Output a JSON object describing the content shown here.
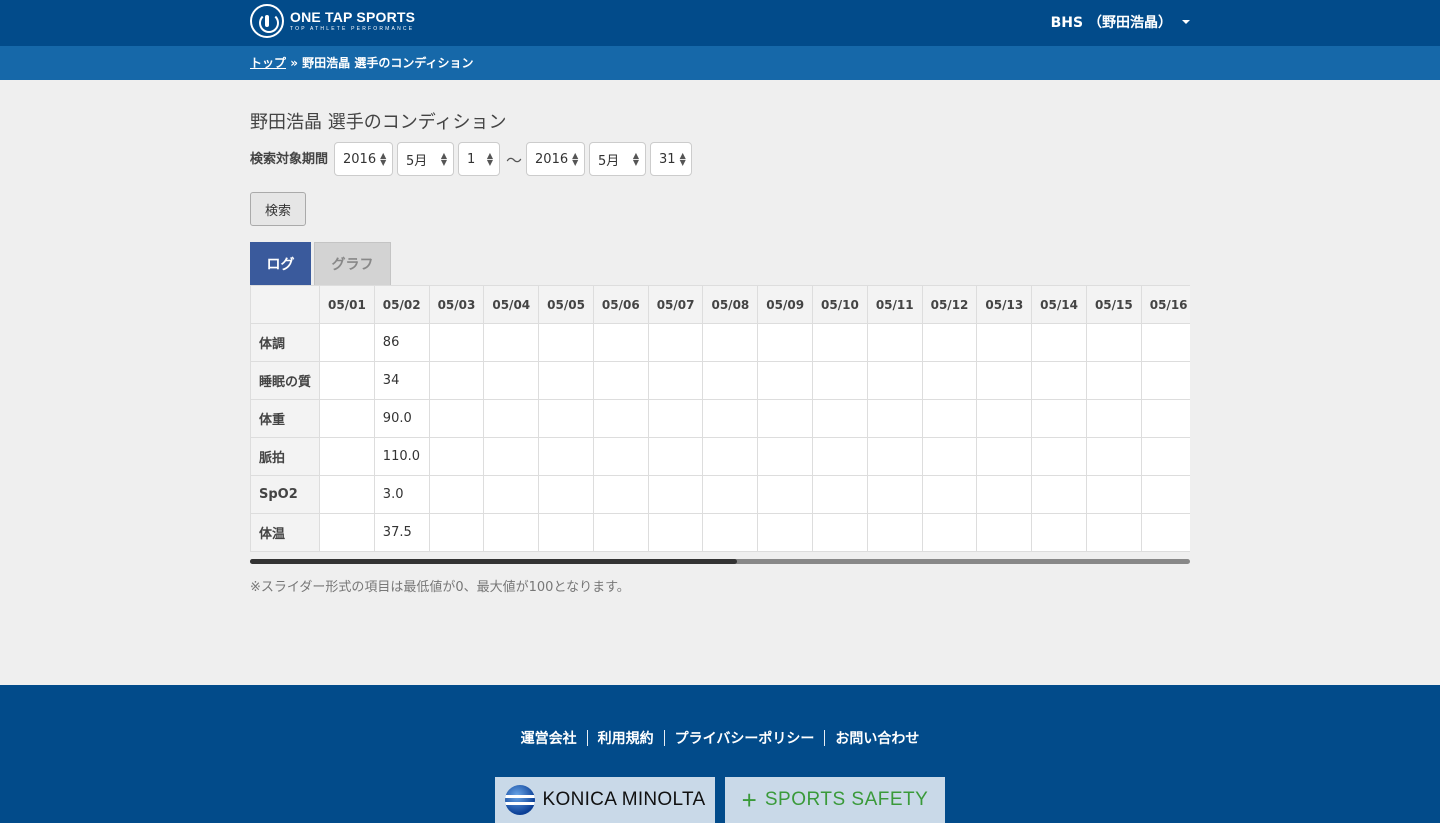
{
  "brand": {
    "name": "ONE TAP SPORTS",
    "tagline": "TOP ATHLETE PERFORMANCE"
  },
  "user_menu": {
    "label": "BHS （野田浩晶）"
  },
  "breadcrumb": {
    "home": "トップ",
    "separator": "»",
    "current": "野田浩晶 選手のコンディション"
  },
  "page": {
    "title": "野田浩晶 選手のコンディション"
  },
  "period": {
    "label": "検索対象期間",
    "from_year": "2016",
    "from_month": "5月",
    "from_day": "1",
    "separator": "〜",
    "to_year": "2016",
    "to_month": "5月",
    "to_day": "31"
  },
  "search_button": "検索",
  "tabs": [
    {
      "label": "ログ",
      "active": true
    },
    {
      "label": "グラフ",
      "active": false
    }
  ],
  "table": {
    "columns": [
      "05/01",
      "05/02",
      "05/03",
      "05/04",
      "05/05",
      "05/06",
      "05/07",
      "05/08",
      "05/09",
      "05/10",
      "05/11",
      "05/12",
      "05/13",
      "05/14",
      "05/15",
      "05/16"
    ],
    "rows": [
      {
        "label": "体調",
        "values": [
          "",
          "86",
          "",
          "",
          "",
          "",
          "",
          "",
          "",
          "",
          "",
          "",
          "",
          "",
          "",
          ""
        ]
      },
      {
        "label": "睡眠の質",
        "values": [
          "",
          "34",
          "",
          "",
          "",
          "",
          "",
          "",
          "",
          "",
          "",
          "",
          "",
          "",
          "",
          ""
        ]
      },
      {
        "label": "体重",
        "values": [
          "",
          "90.0",
          "",
          "",
          "",
          "",
          "",
          "",
          "",
          "",
          "",
          "",
          "",
          "",
          "",
          ""
        ]
      },
      {
        "label": "脈拍",
        "values": [
          "",
          "110.0",
          "",
          "",
          "",
          "",
          "",
          "",
          "",
          "",
          "",
          "",
          "",
          "",
          "",
          ""
        ]
      },
      {
        "label": "SpO2",
        "values": [
          "",
          "3.0",
          "",
          "",
          "",
          "",
          "",
          "",
          "",
          "",
          "",
          "",
          "",
          "",
          "",
          ""
        ]
      },
      {
        "label": "体温",
        "values": [
          "",
          "37.5",
          "",
          "",
          "",
          "",
          "",
          "",
          "",
          "",
          "",
          "",
          "",
          "",
          "",
          ""
        ]
      }
    ]
  },
  "note": "※スライダー形式の項目は最低値が0、最大値が100となります。",
  "footer": {
    "links": [
      "運営会社",
      "利用規約",
      "プライバシーポリシー",
      "お問い合わせ"
    ],
    "partners": [
      {
        "name": "KONICA MINOLTA",
        "icon": "konica-minolta-globe-icon"
      },
      {
        "name": "SPORTS SAFETY",
        "icon": "plus-icon"
      }
    ]
  },
  "colors": {
    "header": "#024b8a",
    "breadcrumb_bar": "#1668a9",
    "active_tab": "#3a5a9c",
    "background": "#efefef"
  }
}
